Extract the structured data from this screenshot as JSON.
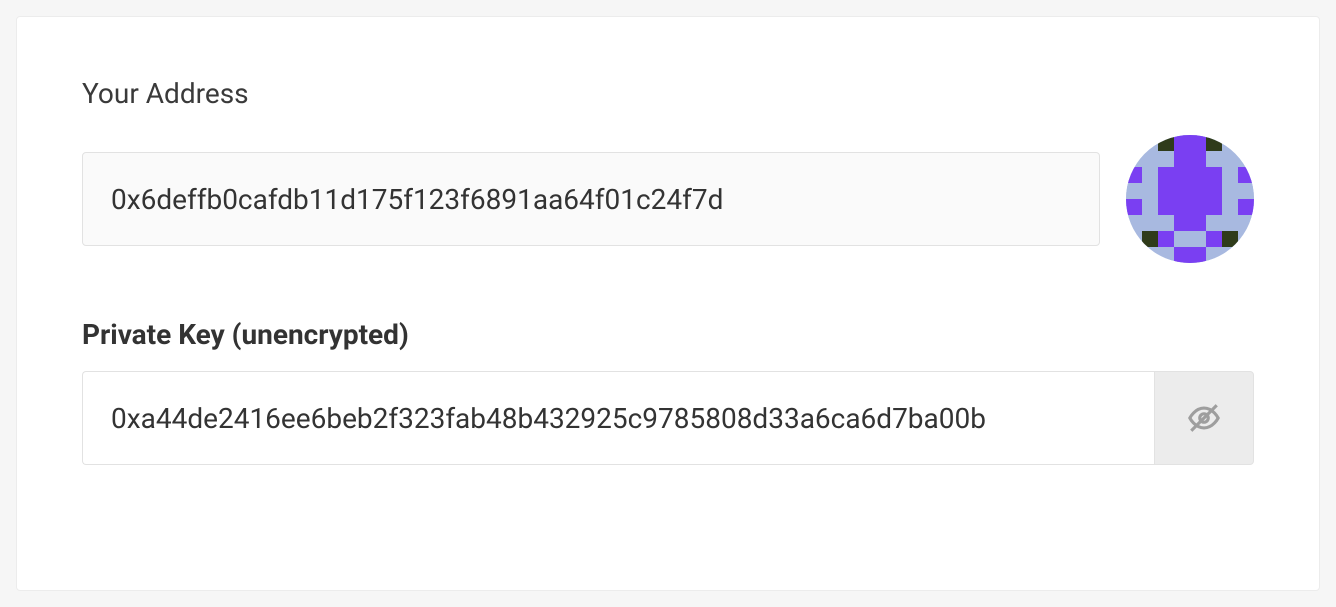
{
  "address": {
    "label": "Your Address",
    "value": "0x6deffb0cafdb11d175f123f6891aa64f01c24f7d"
  },
  "privateKey": {
    "label": "Private Key (unencrypted)",
    "value": "0xa44de2416ee6beb2f323fab48b432925c9785808d33a6ca6d7ba00b"
  },
  "identicon": {
    "colors": {
      "bg": "#a8b9e0",
      "accent1": "#7a3ff2",
      "accent2": "#2f3b1a"
    }
  }
}
